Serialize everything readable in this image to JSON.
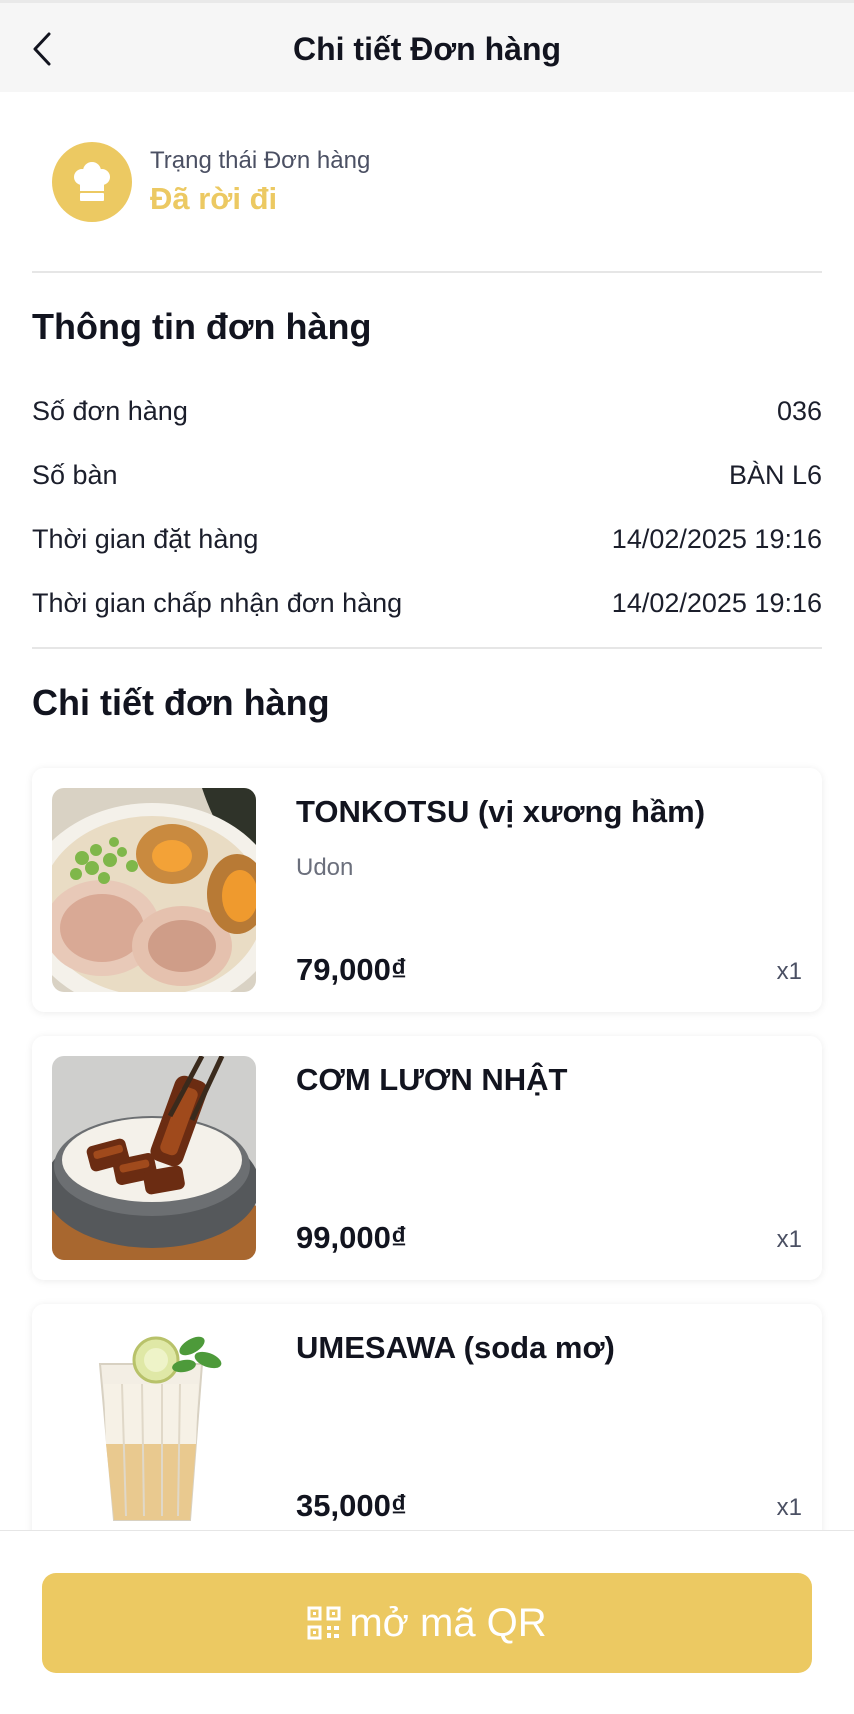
{
  "header": {
    "title": "Chi tiết Đơn hàng",
    "back_icon": "chevron-left-icon"
  },
  "status": {
    "label": "Trạng thái Đơn hàng",
    "value": "Đã rời đi",
    "icon": "chef-hat-icon",
    "accent_color": "#ecc962"
  },
  "order_info": {
    "title": "Thông tin đơn hàng",
    "rows": [
      {
        "label": "Số đơn hàng",
        "value": "036"
      },
      {
        "label": "Số bàn",
        "value": "BÀN L6"
      },
      {
        "label": "Thời gian đặt hàng",
        "value": "14/02/2025 19:16"
      },
      {
        "label": "Thời gian chấp nhận đơn hàng",
        "value": "14/02/2025 19:16"
      }
    ]
  },
  "order_details": {
    "title": "Chi tiết đơn hàng",
    "items": [
      {
        "name": "TONKOTSU (vị xương hầm)",
        "sub": "Udon",
        "price": "79,000₫",
        "qty": "x1"
      },
      {
        "name": "CƠM LƯƠN NHẬT",
        "sub": "",
        "price": "99,000₫",
        "qty": "x1"
      },
      {
        "name": "UMESAWA (soda mơ)",
        "sub": "",
        "price": "35,000₫",
        "qty": "x1"
      }
    ]
  },
  "footer": {
    "qr_button_label": "mở mã QR",
    "qr_icon": "qr-code-icon"
  }
}
